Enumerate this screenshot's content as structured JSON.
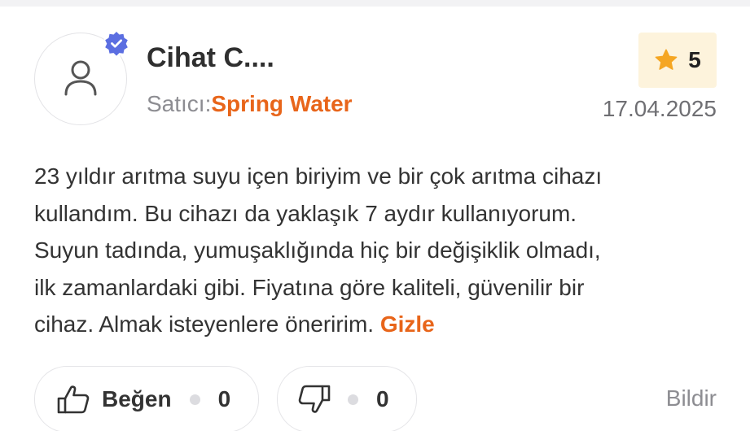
{
  "reviewer": {
    "name": "Cihat C....",
    "avatar_icon": "user-icon",
    "verified_icon": "verified-badge-icon",
    "verified_color": "#5b6ee1"
  },
  "seller": {
    "label": "Satıcı:",
    "name": "Spring Water",
    "accent_color": "#e8651a"
  },
  "rating": {
    "value": "5",
    "icon": "star-icon",
    "star_color": "#f5a623",
    "badge_bg": "#fdf3dc"
  },
  "date": "17.04.2025",
  "review": {
    "lines": [
      "23 yıldır arıtma suyu içen biriyim ve bir çok arıtma cihazı",
      "kullandım. Bu cihazı da yaklaşık 7 aydır kullanıyorum.",
      "Suyun tadında, yumuşaklığında hiç bir değişiklik olmadı,",
      "ilk zamanlardaki gibi. Fiyatına göre kaliteli, güvenilir bir",
      "cihaz. Almak isteyenlere öneririm."
    ],
    "hide_label": "Gizle"
  },
  "actions": {
    "like": {
      "label": "Beğen",
      "count": "0",
      "icon": "thumbs-up-icon"
    },
    "dislike": {
      "count": "0",
      "icon": "thumbs-down-icon"
    },
    "report_label": "Bildir"
  }
}
